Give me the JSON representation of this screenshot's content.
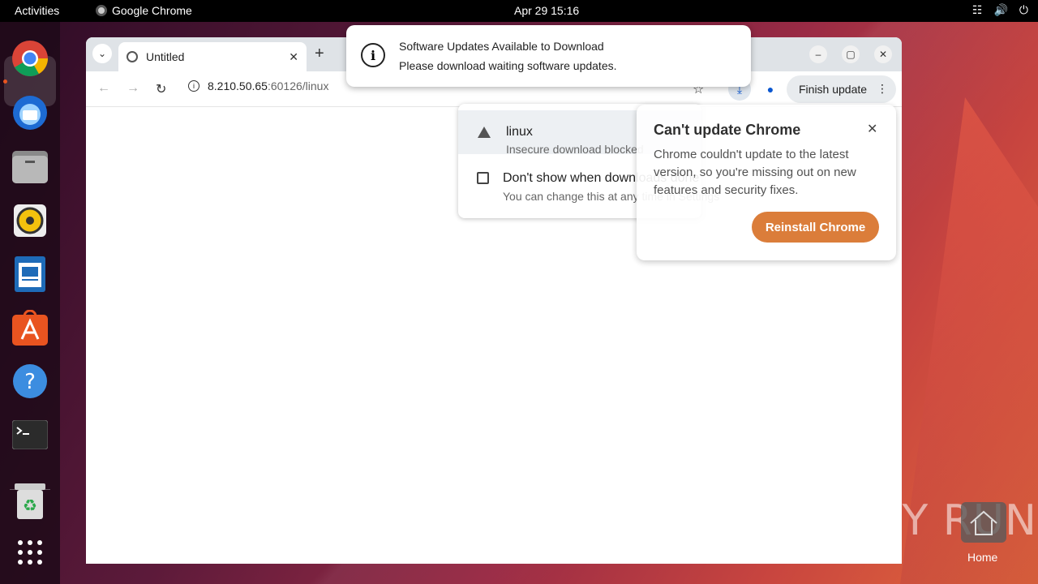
{
  "topbar": {
    "activities": "Activities",
    "app_name": "Google Chrome",
    "clock": "Apr 29  15:16"
  },
  "dock": {
    "items": [
      "Chrome",
      "Thunderbird",
      "Files",
      "Rhythmbox",
      "LibreOffice Writer",
      "App Center",
      "Help",
      "Terminal",
      "Trash",
      "Show Apps"
    ]
  },
  "browser": {
    "tab_title": "Untitled",
    "url_host": "8.210.50.65",
    "url_rest": ":60126/linux",
    "finish_update": "Finish update"
  },
  "notification": {
    "title": "Software Updates Available to Download",
    "body": "Please download waiting software updates."
  },
  "download_bubble": {
    "file_name": "linux",
    "status": "Insecure download blocked",
    "dont_show": "Don't show when downloads done",
    "change_hint": "You can change this at any time in Settings"
  },
  "update_card": {
    "title": "Can't update Chrome",
    "body": "Chrome couldn't update to the latest version, so you're missing out on new features and security fixes.",
    "button": "Reinstall Chrome"
  },
  "desktop": {
    "watermark": "ANY RUN",
    "home_label": "Home"
  },
  "colors": {
    "accent_orange": "#d9722a",
    "chrome_blue": "#0b57d0",
    "ubuntu_orange": "#e95420"
  }
}
